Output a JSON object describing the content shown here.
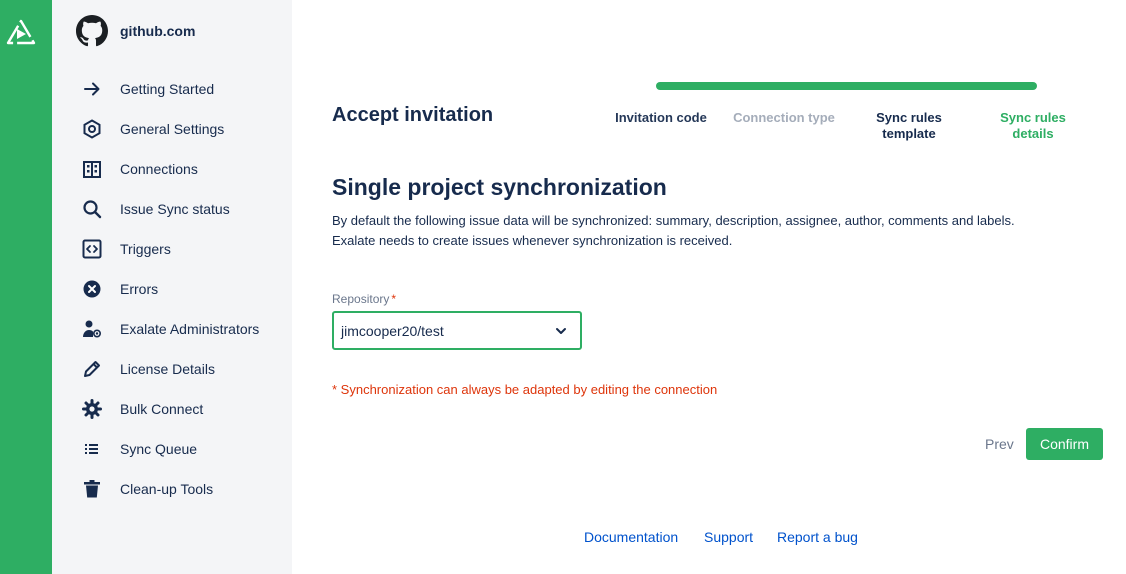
{
  "sidebar": {
    "host": "github.com",
    "items": [
      {
        "label": "Getting Started",
        "icon": "arrow-right-icon"
      },
      {
        "label": "General Settings",
        "icon": "hexagon-settings-icon"
      },
      {
        "label": "Connections",
        "icon": "building-icon"
      },
      {
        "label": "Issue Sync status",
        "icon": "search-icon"
      },
      {
        "label": "Triggers",
        "icon": "code-brackets-icon"
      },
      {
        "label": "Errors",
        "icon": "error-x-circle-icon"
      },
      {
        "label": "Exalate Administrators",
        "icon": "admin-user-icon"
      },
      {
        "label": "License Details",
        "icon": "pencil-icon"
      },
      {
        "label": "Bulk Connect",
        "icon": "gear-icon"
      },
      {
        "label": "Sync Queue",
        "icon": "list-icon"
      },
      {
        "label": "Clean-up Tools",
        "icon": "trash-icon"
      }
    ]
  },
  "wizard": {
    "title": "Accept invitation",
    "progress_percent": 100,
    "steps": [
      {
        "label": "Invitation code",
        "state": "done"
      },
      {
        "label": "Connection type",
        "state": "disabled"
      },
      {
        "label": "Sync rules template",
        "state": "done"
      },
      {
        "label": "Sync rules details",
        "state": "active"
      }
    ]
  },
  "content": {
    "section_title": "Single project synchronization",
    "desc_line1": "By default the following issue data will be synchronized: summary, description, assignee, author, comments and labels.",
    "desc_line2": "Exalate needs to create issues whenever synchronization is received.",
    "repo_label": "Repository",
    "required_mark": "*",
    "repo_value": "jimcooper20/test",
    "note": "* Synchronization can always be adapted by editing the connection"
  },
  "actions": {
    "prev": "Prev",
    "confirm": "Confirm"
  },
  "footer": {
    "links": [
      "Documentation",
      "Support",
      "Report a bug"
    ]
  },
  "colors": {
    "brand_green": "#2eae63",
    "error_red": "#de350b",
    "link_blue": "#0052cc"
  }
}
